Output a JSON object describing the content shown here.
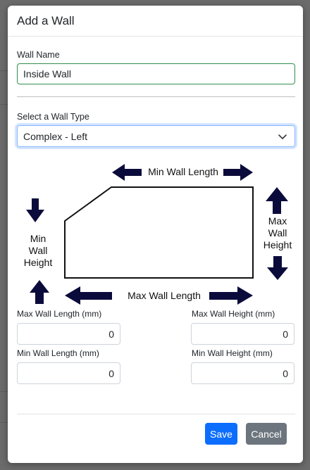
{
  "modal": {
    "title": "Add a Wall",
    "wall_name_label": "Wall Name",
    "wall_name_value": "Inside Wall",
    "wall_type_label": "Select a Wall Type",
    "wall_type_value": "Complex - Left"
  },
  "diagram": {
    "min_wall_length": "Min Wall Length",
    "max_wall_length": "Max Wall Length",
    "min_wall_height": [
      "Min",
      "Wall",
      "Height"
    ],
    "max_wall_height": [
      "Max",
      "Wall",
      "Height"
    ]
  },
  "fields": {
    "max_length_label": "Max Wall Length (mm)",
    "max_length_value": "0",
    "max_height_label": "Max Wall Height (mm)",
    "max_height_value": "0",
    "min_length_label": "Min Wall Length (mm)",
    "min_length_value": "0",
    "min_height_label": "Min Wall Height (mm)",
    "min_height_value": "0"
  },
  "footer": {
    "save_label": "Save",
    "cancel_label": "Cancel"
  },
  "colors": {
    "primary": "#0d6efd",
    "secondary": "#6c757d",
    "arrow": "#0b0b3b"
  }
}
